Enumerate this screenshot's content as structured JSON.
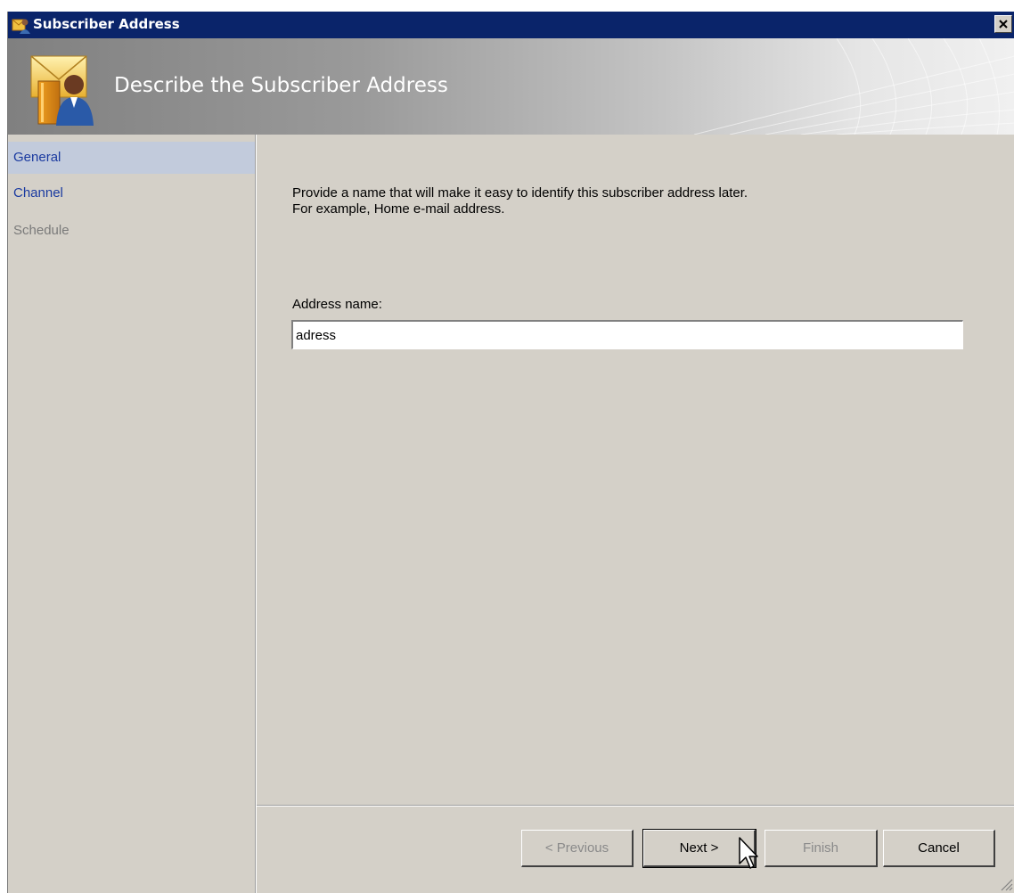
{
  "window": {
    "title": "Subscriber Address",
    "title_icon": "subscriber-address-icon",
    "close_icon": "close-icon"
  },
  "banner": {
    "title": "Describe the Subscriber Address",
    "icon": "subscriber-envelope-person-icon"
  },
  "nav": {
    "items": [
      {
        "label": "General",
        "state": "selected"
      },
      {
        "label": "Channel",
        "state": "enabled"
      },
      {
        "label": "Schedule",
        "state": "disabled"
      }
    ]
  },
  "content": {
    "instruction_line1": "Provide a name that will make it easy to identify this subscriber address later.",
    "instruction_line2": "For example, Home e-mail address.",
    "address_label": "Address name:",
    "address_value": "adress"
  },
  "buttons": {
    "previous": "< Previous",
    "next": "Next >",
    "finish": "Finish",
    "cancel": "Cancel"
  },
  "colors": {
    "titlebar": "#0a246a",
    "dialog_bg": "#d4d0c8",
    "nav_selected": "#c2cbdc",
    "nav_link": "#1a3aa0",
    "nav_disabled": "#7a7a7a"
  }
}
